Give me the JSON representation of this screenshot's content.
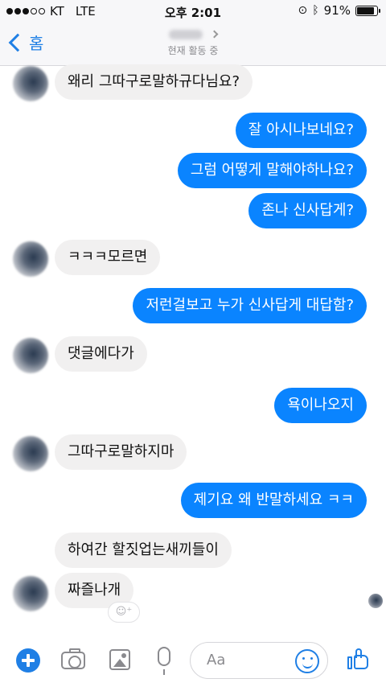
{
  "status_bar": {
    "carrier": "KT",
    "network": "LTE",
    "time": "오후 2:01",
    "battery": "91%",
    "battery_level": 0.91
  },
  "nav": {
    "back_label": "홈",
    "status": "현재 활동 중"
  },
  "messages": [
    {
      "side": "in",
      "text": "왜리 그따구로말하규다님요?"
    },
    {
      "side": "out",
      "text": "잘 아시나보네요?"
    },
    {
      "side": "out",
      "text": "그럼 어떻게 말해야하나요?"
    },
    {
      "side": "out",
      "text": "존나 신사답게?"
    },
    {
      "side": "in",
      "text": "ㅋㅋㅋ모르면"
    },
    {
      "side": "out",
      "text": "저런걸보고 누가 신사답게 대답함?"
    },
    {
      "side": "in",
      "text": "댓글에다가"
    },
    {
      "side": "out",
      "text": "욕이나오지"
    },
    {
      "side": "in",
      "text": "그따구로말하지마"
    },
    {
      "side": "out",
      "text": "제기요 왜 반말하세요 ㅋㅋ"
    },
    {
      "side": "in",
      "text": "하여간 할짓업는새끼들이"
    },
    {
      "side": "in",
      "text": "짜즐나개"
    }
  ],
  "composer": {
    "placeholder": "Aa"
  },
  "colors": {
    "accent": "#1f7fe5",
    "outgoing_bubble": "#0a84ff",
    "incoming_bubble": "#f1f0f0"
  }
}
